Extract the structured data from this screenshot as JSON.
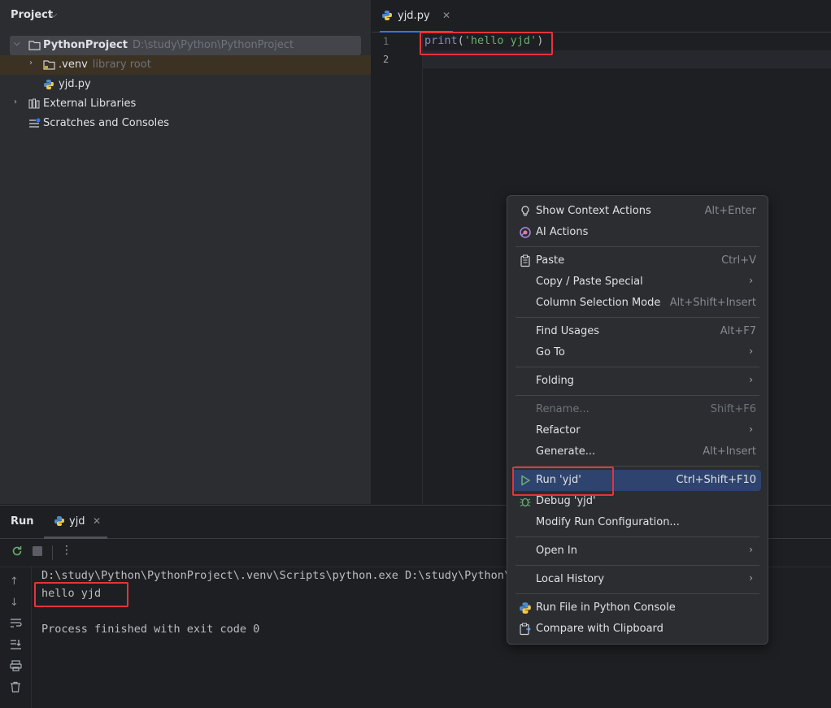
{
  "project_panel": {
    "title": "Project",
    "tree": [
      {
        "label": "PythonProject",
        "hint": "D:\\study\\Python\\PythonProject"
      },
      {
        "label": ".venv",
        "hint": "library root"
      },
      {
        "label": "yjd.py"
      },
      {
        "label": "External Libraries"
      },
      {
        "label": "Scratches and Consoles"
      }
    ]
  },
  "editor": {
    "tab_label": "yjd.py",
    "line_numbers": [
      "1",
      "2"
    ],
    "code": {
      "func": "print",
      "open": "(",
      "string": "'hello yjd'",
      "close": ")"
    }
  },
  "run_panel": {
    "title": "Run",
    "tab_label": "yjd",
    "console": [
      "D:\\study\\Python\\PythonProject\\.venv\\Scripts\\python.exe D:\\study\\Python\\P",
      "hello yjd",
      "",
      "Process finished with exit code 0"
    ]
  },
  "context_menu": {
    "items": [
      {
        "label": "Show Context Actions",
        "shortcut": "Alt+Enter",
        "icon": "bulb-icon"
      },
      {
        "label": "AI Actions",
        "icon": "ai-icon"
      },
      {
        "label": "Paste",
        "shortcut": "Ctrl+V",
        "icon": "clipboard-icon"
      },
      {
        "label": "Copy / Paste Special",
        "submenu": true
      },
      {
        "label": "Column Selection Mode",
        "shortcut": "Alt+Shift+Insert"
      },
      {
        "label": "Find Usages",
        "shortcut": "Alt+F7"
      },
      {
        "label": "Go To",
        "submenu": true
      },
      {
        "label": "Folding",
        "submenu": true
      },
      {
        "label": "Rename...",
        "shortcut": "Shift+F6",
        "disabled": true
      },
      {
        "label": "Refactor",
        "submenu": true
      },
      {
        "label": "Generate...",
        "shortcut": "Alt+Insert"
      },
      {
        "label": "Run 'yjd'",
        "shortcut": "Ctrl+Shift+F10",
        "icon": "run-icon",
        "active": true
      },
      {
        "label": "Debug 'yjd'",
        "icon": "debug-icon"
      },
      {
        "label": "Modify Run Configuration..."
      },
      {
        "label": "Open In",
        "submenu": true
      },
      {
        "label": "Local History",
        "submenu": true
      },
      {
        "label": "Run File in Python Console",
        "icon": "python-icon"
      },
      {
        "label": "Compare with Clipboard",
        "icon": "compare-icon"
      }
    ],
    "submenu_glyph": "›"
  },
  "colors": {
    "accent": "#3574f0",
    "selection": "#2e436e",
    "highlight_box": "#e5343a",
    "string": "#6aab73",
    "builtin": "#8888c6"
  }
}
